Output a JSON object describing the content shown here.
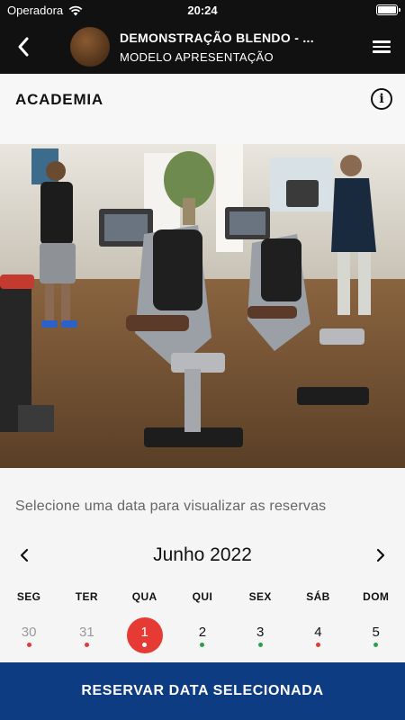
{
  "status_bar": {
    "carrier": "Operadora",
    "time": "20:24"
  },
  "header": {
    "title": "DEMONSTRAÇÃO BLENDO - ...",
    "subtitle": "MODELO APRESENTAÇÃO",
    "icons": {
      "back": "chevron-left-icon",
      "menu": "hamburger-menu-icon"
    }
  },
  "section": {
    "title": "ACADEMIA",
    "info_icon": "info-icon"
  },
  "prompt": "Selecione uma data para visualizar as reservas",
  "calendar": {
    "month_label": "Junho 2022",
    "weekdays": [
      "SEG",
      "TER",
      "QUA",
      "QUI",
      "SEX",
      "SÁB",
      "DOM"
    ],
    "days": [
      {
        "label": "30",
        "muted": true,
        "selected": false,
        "status": "unavailable"
      },
      {
        "label": "31",
        "muted": true,
        "selected": false,
        "status": "unavailable"
      },
      {
        "label": "1",
        "muted": false,
        "selected": true,
        "status": "selected"
      },
      {
        "label": "2",
        "muted": false,
        "selected": false,
        "status": "available"
      },
      {
        "label": "3",
        "muted": false,
        "selected": false,
        "status": "available"
      },
      {
        "label": "4",
        "muted": false,
        "selected": false,
        "status": "unavailable"
      },
      {
        "label": "5",
        "muted": false,
        "selected": false,
        "status": "available"
      }
    ]
  },
  "footer": {
    "reserve_label": "RESERVAR DATA SELECIONADA"
  },
  "colors": {
    "header_bg": "#111111",
    "accent_red": "#e63a35",
    "available_green": "#2e9e44",
    "unavailable_red": "#e03c31",
    "cta_blue": "#0d3c83"
  }
}
